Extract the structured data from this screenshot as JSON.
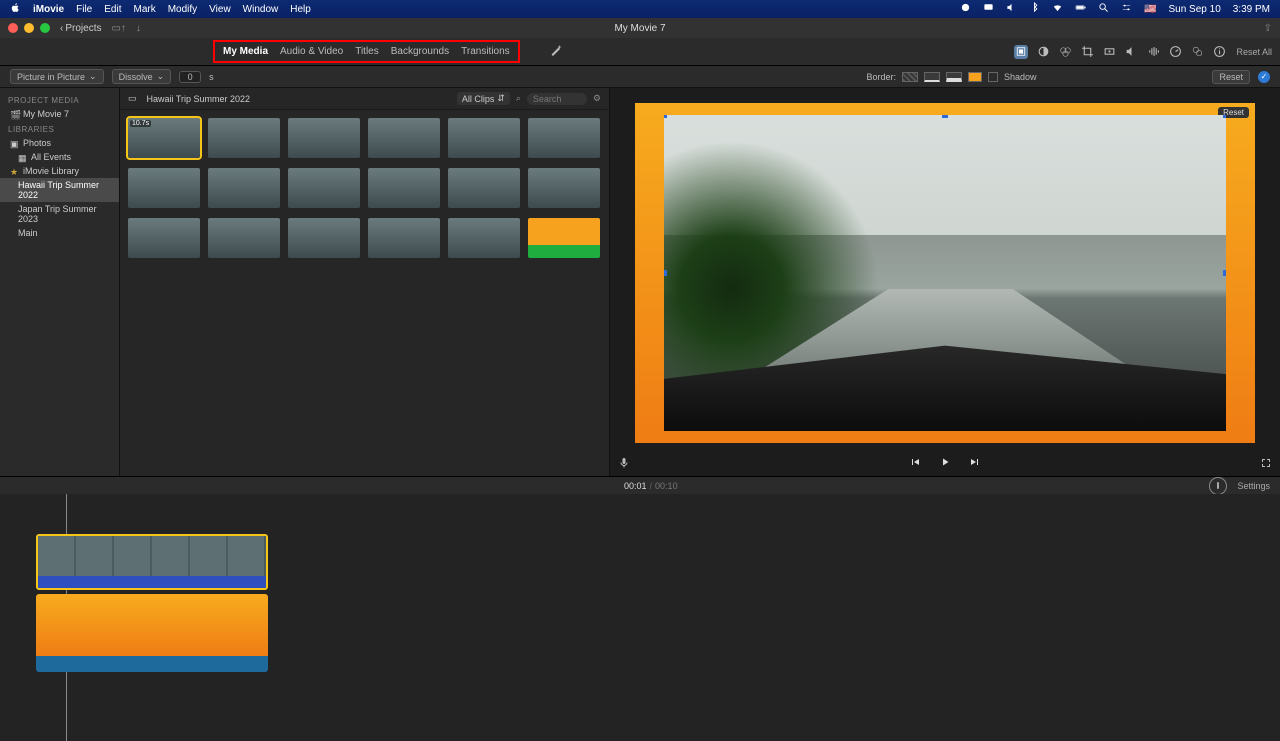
{
  "menubar": {
    "app": "iMovie",
    "items": [
      "File",
      "Edit",
      "Mark",
      "Modify",
      "View",
      "Window",
      "Help"
    ],
    "date": "Sun Sep 10",
    "time": "3:39 PM"
  },
  "titlebar": {
    "projects_label": "Projects",
    "title": "My Movie 7"
  },
  "tabs": {
    "my_media": "My Media",
    "audio_video": "Audio & Video",
    "titles": "Titles",
    "backgrounds": "Backgrounds",
    "transitions": "Transitions"
  },
  "toolbar": {
    "reset_all": "Reset All"
  },
  "inspector": {
    "mode": "Picture in Picture",
    "transition": "Dissolve",
    "value": "0",
    "border_label": "Border:",
    "shadow_label": "Shadow",
    "reset": "Reset"
  },
  "sidebar": {
    "project_media": "PROJECT MEDIA",
    "movie": "My Movie 7",
    "libraries": "LIBRARIES",
    "photos": "Photos",
    "all_events": "All Events",
    "imovie_library": "iMovie Library",
    "events": [
      "Hawaii Trip Summer 2022",
      "Japan Trip Summer 2023",
      "Main"
    ]
  },
  "browser": {
    "title": "Hawaii Trip Summer 2022",
    "all_clips": "All Clips",
    "search_placeholder": "Search",
    "first_thumb_duration": "10.7s"
  },
  "viewer": {
    "pip_reset": "Reset",
    "time_current": "00:01",
    "time_total": "00:10"
  },
  "timeline": {
    "settings": "Settings"
  }
}
